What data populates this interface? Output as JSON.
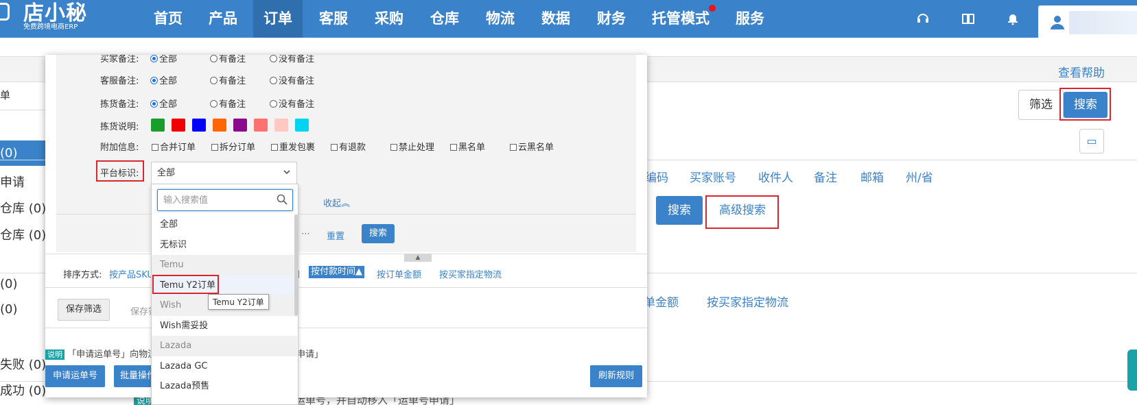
{
  "brand": {
    "name": "店小秘",
    "tagline": "免费跨境电商ERP"
  },
  "nav": {
    "items": [
      "首页",
      "产品",
      "订单",
      "客服",
      "采购",
      "仓库",
      "物流",
      "数据",
      "财务",
      "托管模式",
      "服务"
    ],
    "active": "订单"
  },
  "background": {
    "left_rows": [
      "单",
      "(0)",
      "申请",
      "仓库 (0)",
      "仓库 (0)",
      "(0)",
      "(0)",
      "失败 (0)",
      "成功 (0)"
    ],
    "help_link": "查看帮助",
    "filter_button": "筛选",
    "search_button": "搜索",
    "field_links": [
      "编码",
      "买家账号",
      "收件人",
      "备注",
      "邮箱",
      "州/省"
    ],
    "search_button_2": "搜索",
    "advanced_search": "高级搜索",
    "sort_links": [
      "单金额",
      "按买家指定物流"
    ],
    "note_tag": "说明",
    "note_text": "「申请运单号」向物流商申请运单号，并自动移入「运单号申请」"
  },
  "popup": {
    "filters": {
      "buyer_note": {
        "label": "买家备注:",
        "options": [
          "全部",
          "有备注",
          "没有备注"
        ]
      },
      "cs_note": {
        "label": "客服备注:",
        "options": [
          "全部",
          "有备注",
          "没有备注"
        ]
      },
      "pick_note": {
        "label": "拣货备注:",
        "options": [
          "全部",
          "有备注",
          "没有备注"
        ]
      },
      "pick_desc": {
        "label": "拣货说明:",
        "colors": [
          "#1a9e2b",
          "#f00000",
          "#0000ff",
          "#ff6600",
          "#8b0a8b",
          "#ff7070",
          "#ffc8c0",
          "#00d4f0"
        ]
      },
      "extra_info": {
        "label": "附加信息:",
        "options": [
          "合并订单",
          "拆分订单",
          "重发包裹",
          "有退款",
          "禁止处理",
          "黑名单",
          "云黑名单"
        ]
      },
      "platform": {
        "label": "平台标识:",
        "selected": "全部"
      }
    },
    "collapse": "收起︽",
    "left_fragment": "⋯",
    "reset": "重置",
    "search": "搜索",
    "sort": {
      "label": "排序方式:",
      "items": [
        "按产品SKU",
        "时间",
        "按付款时间▲",
        "按订单金额",
        "按买家指定物流"
      ],
      "active": "按付款时间▲"
    },
    "save_filter": "保存筛选",
    "save_fragment": "保存筛",
    "note_tag": "说明",
    "note_text": "「申请运单号」向物流",
    "note_tail": "申请」",
    "apply_waybill": "申请运单号",
    "batch_ops": "批量操作",
    "refresh_rules": "刷新规则"
  },
  "dropdown": {
    "search_placeholder": "输入搜索值",
    "items": [
      {
        "label": "全部",
        "group": false
      },
      {
        "label": "无标识",
        "group": false
      },
      {
        "label": "Temu",
        "group": true
      },
      {
        "label": "Temu Y2订单",
        "group": false,
        "hover": true
      },
      {
        "label": "Wish",
        "group": true
      },
      {
        "label": "Wish需妥投",
        "group": false
      },
      {
        "label": "Lazada",
        "group": true
      },
      {
        "label": "Lazada GC",
        "group": false
      },
      {
        "label": "Lazada预售",
        "group": false
      }
    ],
    "tooltip": "Temu Y2订单"
  }
}
